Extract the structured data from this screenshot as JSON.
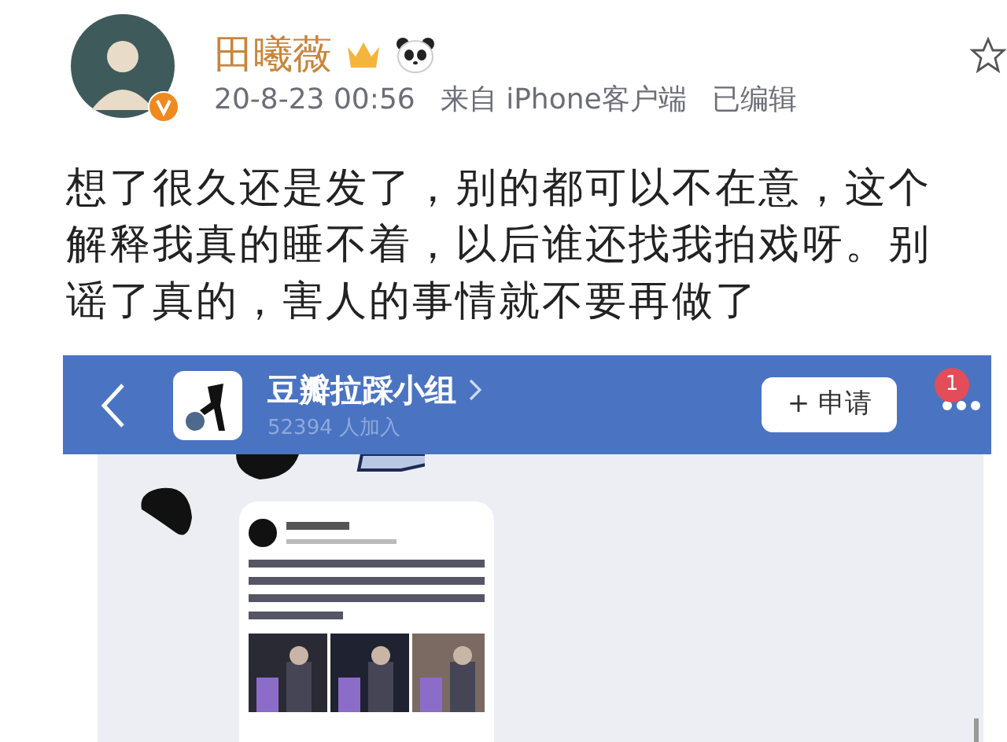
{
  "post": {
    "author": "田曦薇",
    "verified": true,
    "timestamp": "20-8-23 00:56",
    "source": "来自 iPhone客户端",
    "edited": "已编辑",
    "text_lines": [
      "想了很久还是发了，别的都可以不在意，这个",
      "解释我真的睡不着，以后谁还找我拍戏呀。别",
      "谣了真的，害人的事情就不要再做了"
    ]
  },
  "group_header": {
    "title": "豆瓣拉踩小组",
    "members": "52394 人加入",
    "join_button": "+ 申请",
    "notification_count": "1"
  }
}
